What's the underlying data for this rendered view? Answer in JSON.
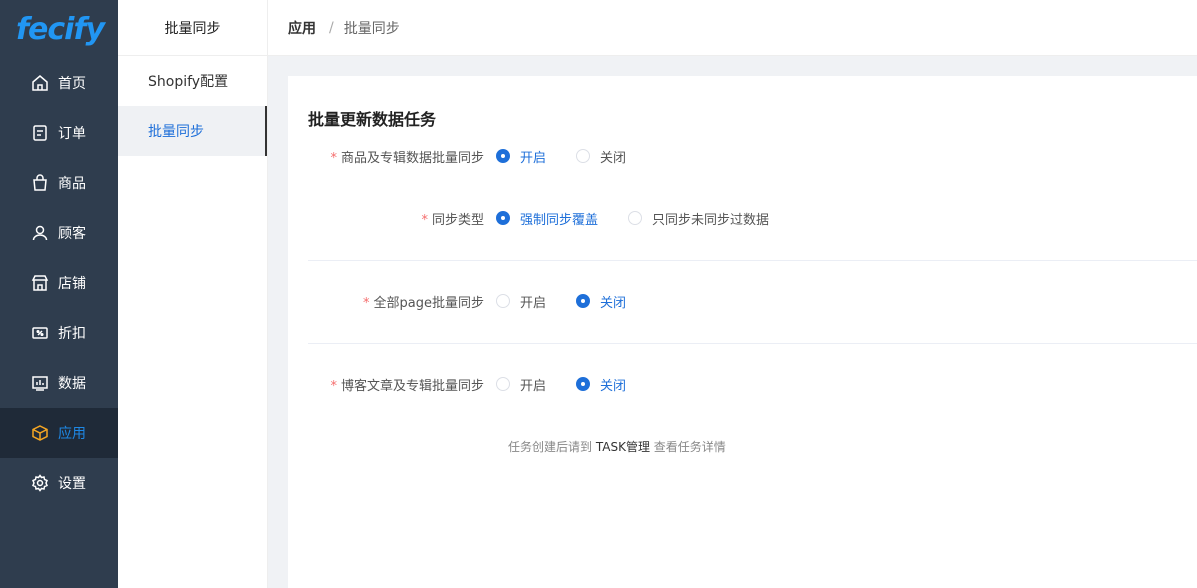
{
  "logo": "fecify",
  "nav": [
    {
      "label": "首页",
      "icon": "home-icon"
    },
    {
      "label": "订单",
      "icon": "order-icon"
    },
    {
      "label": "商品",
      "icon": "bag-icon"
    },
    {
      "label": "顾客",
      "icon": "user-icon"
    },
    {
      "label": "店铺",
      "icon": "store-icon"
    },
    {
      "label": "折扣",
      "icon": "ticket-icon"
    },
    {
      "label": "数据",
      "icon": "chart-icon"
    },
    {
      "label": "应用",
      "icon": "cube-icon",
      "active": true
    },
    {
      "label": "设置",
      "icon": "gear-icon"
    }
  ],
  "subnav": {
    "title": "批量同步",
    "items": [
      {
        "label": "Shopify配置"
      },
      {
        "label": "批量同步",
        "active": true
      }
    ]
  },
  "breadcrumb": {
    "root": "应用",
    "separator": "/",
    "current": "批量同步"
  },
  "card": {
    "title": "批量更新数据任务",
    "rows": [
      {
        "label": "商品及专辑数据批量同步",
        "required": "*",
        "options": [
          "开启",
          "关闭"
        ],
        "selected": 0
      },
      {
        "label": "同步类型",
        "required": "*",
        "options": [
          "强制同步覆盖",
          "只同步未同步过数据"
        ],
        "selected": 0
      },
      {
        "label": "全部page批量同步",
        "required": "*",
        "options": [
          "开启",
          "关闭"
        ],
        "selected": 1
      },
      {
        "label": "博客文章及专辑批量同步",
        "required": "*",
        "options": [
          "开启",
          "关闭"
        ],
        "selected": 1
      }
    ],
    "note": {
      "before": "任务创建后请到",
      "highlight": "TASK管理",
      "after": "查看任务详情"
    }
  },
  "colors": {
    "sidebar": "#2f3d4e",
    "active_bg": "#1f2a38",
    "accent": "#1e6fd9",
    "logo": "#2196f3",
    "logo_swoosh": "#f5a623"
  }
}
